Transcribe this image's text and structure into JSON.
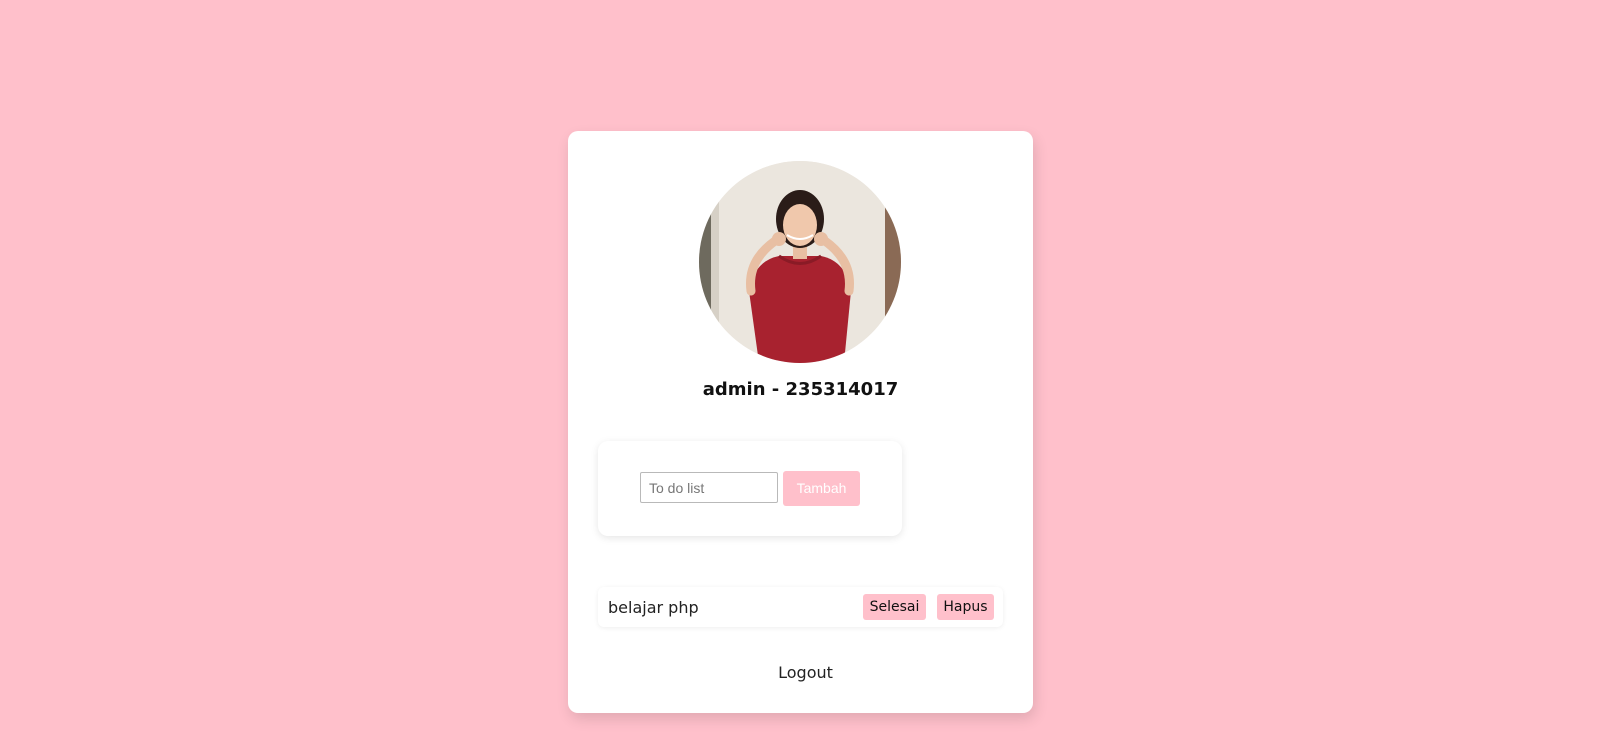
{
  "profile": {
    "username": "admin - 235314017"
  },
  "todo_form": {
    "placeholder": "To do list",
    "value": "",
    "add_label": "Tambah"
  },
  "tasks": [
    {
      "text": "belajar php",
      "done_label": "Selesai",
      "delete_label": "Hapus"
    }
  ],
  "logout_label": "Logout",
  "colors": {
    "background": "#ffc0cb",
    "card": "#ffffff",
    "accent": "#ffc0cb"
  }
}
